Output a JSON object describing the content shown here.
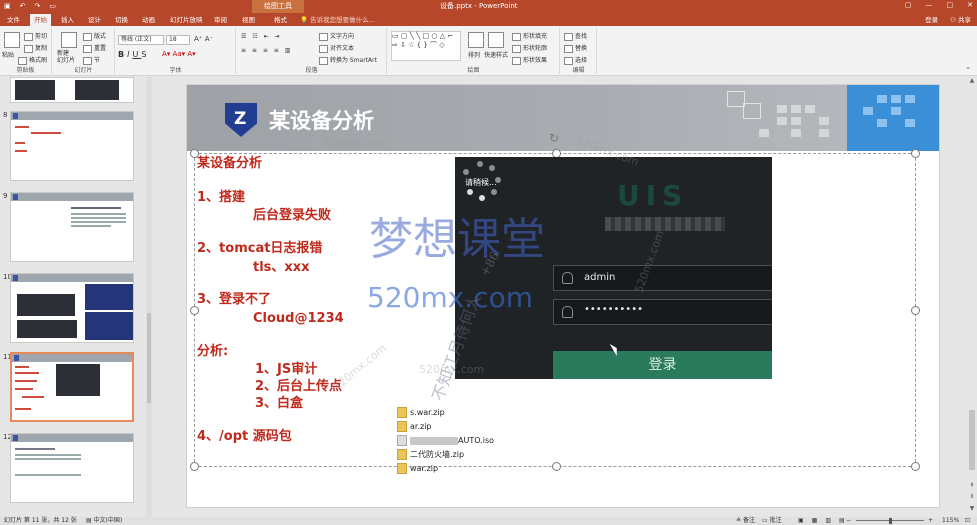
{
  "window": {
    "document_title": "设备.pptx - PowerPoint",
    "context_tab": "绘图工具",
    "qat_icons": [
      "save-icon",
      "undo-icon",
      "redo-icon",
      "slideshow-icon"
    ]
  },
  "ribbon_tabs": {
    "items": [
      "文件",
      "开始",
      "插入",
      "设计",
      "切换",
      "动画",
      "幻灯片放映",
      "审阅",
      "视图",
      "格式"
    ],
    "active": "开始",
    "tell_me": "告诉我您想要做什么...",
    "login": "登录",
    "share": "共享"
  },
  "ribbon": {
    "clipboard": {
      "paste": "粘贴",
      "cut": "剪切",
      "copy": "复制",
      "format_painter": "格式刷",
      "label": "剪贴板"
    },
    "slides": {
      "new_slide": "新建\n幻灯片",
      "layout": "版式",
      "reset": "重置",
      "section": "节",
      "label": "幻灯片"
    },
    "font": {
      "font_name": "等线 (正文)",
      "font_size": "18",
      "label": "字体"
    },
    "paragraph": {
      "text_direction": "文字方向",
      "align_text": "对齐文本",
      "smartart": "转换为 SmartArt",
      "label": "段落"
    },
    "drawing": {
      "arrange": "排列",
      "quick_styles": "快速样式",
      "shape_fill": "形状填充",
      "shape_outline": "形状轮廓",
      "shape_effects": "形状效果",
      "label": "绘图"
    },
    "editing": {
      "find": "查找",
      "replace": "替换",
      "select": "选择",
      "label": "编辑"
    }
  },
  "thumbnails": {
    "numbers": [
      "8",
      "9",
      "10",
      "11",
      "12"
    ]
  },
  "slide": {
    "title": "某设备分析",
    "lines": [
      "某设备分析",
      "1、搭建",
      "后台登录失败",
      "2、tomcat日志报错",
      "tls、xxx",
      "3、登录不了",
      "Cloud@1234",
      "分析:",
      "1、JS审计",
      "2、后台上传点",
      "3、白盒",
      "4、/opt  源码包"
    ],
    "screenshot": {
      "loading_text": "请稍候...",
      "brand": "UIS",
      "username": "admin",
      "password": "••••••••••",
      "login_button": "登录"
    },
    "files": [
      "s.war.zip",
      "ar.zip",
      "AUTO.iso",
      "二代防火墙.zip",
      "war.zip"
    ],
    "watermarks": {
      "main": "梦想课堂",
      "url": "520mx.com",
      "side": "不知江月待何人",
      "phone": "+86"
    }
  },
  "status": {
    "slide_info": "幻灯片 第 11 张，共 12 张",
    "language": "中文(中国)",
    "notes": "备注",
    "comments": "批注",
    "zoom": "115%"
  }
}
